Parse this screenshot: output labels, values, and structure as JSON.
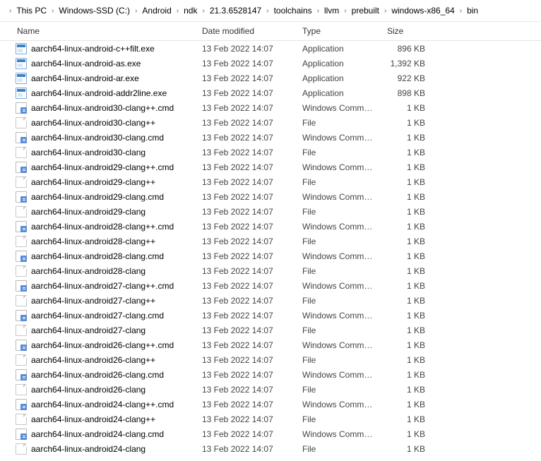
{
  "breadcrumb": [
    "This PC",
    "Windows-SSD (C:)",
    "Android",
    "ndk",
    "21.3.6528147",
    "toolchains",
    "llvm",
    "prebuilt",
    "windows-x86_64",
    "bin"
  ],
  "columns": {
    "name": "Name",
    "date": "Date modified",
    "type": "Type",
    "size": "Size"
  },
  "files": [
    {
      "icon": "exe",
      "name": "aarch64-linux-android-c++filt.exe",
      "date": "13 Feb 2022 14:07",
      "type": "Application",
      "size": "896 KB"
    },
    {
      "icon": "exe",
      "name": "aarch64-linux-android-as.exe",
      "date": "13 Feb 2022 14:07",
      "type": "Application",
      "size": "1,392 KB"
    },
    {
      "icon": "exe",
      "name": "aarch64-linux-android-ar.exe",
      "date": "13 Feb 2022 14:07",
      "type": "Application",
      "size": "922 KB"
    },
    {
      "icon": "exe",
      "name": "aarch64-linux-android-addr2line.exe",
      "date": "13 Feb 2022 14:07",
      "type": "Application",
      "size": "898 KB"
    },
    {
      "icon": "cmd",
      "name": "aarch64-linux-android30-clang++.cmd",
      "date": "13 Feb 2022 14:07",
      "type": "Windows Comma...",
      "size": "1 KB"
    },
    {
      "icon": "file",
      "name": "aarch64-linux-android30-clang++",
      "date": "13 Feb 2022 14:07",
      "type": "File",
      "size": "1 KB"
    },
    {
      "icon": "cmd",
      "name": "aarch64-linux-android30-clang.cmd",
      "date": "13 Feb 2022 14:07",
      "type": "Windows Comma...",
      "size": "1 KB"
    },
    {
      "icon": "file",
      "name": "aarch64-linux-android30-clang",
      "date": "13 Feb 2022 14:07",
      "type": "File",
      "size": "1 KB"
    },
    {
      "icon": "cmd",
      "name": "aarch64-linux-android29-clang++.cmd",
      "date": "13 Feb 2022 14:07",
      "type": "Windows Comma...",
      "size": "1 KB"
    },
    {
      "icon": "file",
      "name": "aarch64-linux-android29-clang++",
      "date": "13 Feb 2022 14:07",
      "type": "File",
      "size": "1 KB"
    },
    {
      "icon": "cmd",
      "name": "aarch64-linux-android29-clang.cmd",
      "date": "13 Feb 2022 14:07",
      "type": "Windows Comma...",
      "size": "1 KB"
    },
    {
      "icon": "file",
      "name": "aarch64-linux-android29-clang",
      "date": "13 Feb 2022 14:07",
      "type": "File",
      "size": "1 KB"
    },
    {
      "icon": "cmd",
      "name": "aarch64-linux-android28-clang++.cmd",
      "date": "13 Feb 2022 14:07",
      "type": "Windows Comma...",
      "size": "1 KB"
    },
    {
      "icon": "file",
      "name": "aarch64-linux-android28-clang++",
      "date": "13 Feb 2022 14:07",
      "type": "File",
      "size": "1 KB"
    },
    {
      "icon": "cmd",
      "name": "aarch64-linux-android28-clang.cmd",
      "date": "13 Feb 2022 14:07",
      "type": "Windows Comma...",
      "size": "1 KB"
    },
    {
      "icon": "file",
      "name": "aarch64-linux-android28-clang",
      "date": "13 Feb 2022 14:07",
      "type": "File",
      "size": "1 KB"
    },
    {
      "icon": "cmd",
      "name": "aarch64-linux-android27-clang++.cmd",
      "date": "13 Feb 2022 14:07",
      "type": "Windows Comma...",
      "size": "1 KB"
    },
    {
      "icon": "file",
      "name": "aarch64-linux-android27-clang++",
      "date": "13 Feb 2022 14:07",
      "type": "File",
      "size": "1 KB"
    },
    {
      "icon": "cmd",
      "name": "aarch64-linux-android27-clang.cmd",
      "date": "13 Feb 2022 14:07",
      "type": "Windows Comma...",
      "size": "1 KB"
    },
    {
      "icon": "file",
      "name": "aarch64-linux-android27-clang",
      "date": "13 Feb 2022 14:07",
      "type": "File",
      "size": "1 KB"
    },
    {
      "icon": "cmd",
      "name": "aarch64-linux-android26-clang++.cmd",
      "date": "13 Feb 2022 14:07",
      "type": "Windows Comma...",
      "size": "1 KB"
    },
    {
      "icon": "file",
      "name": "aarch64-linux-android26-clang++",
      "date": "13 Feb 2022 14:07",
      "type": "File",
      "size": "1 KB"
    },
    {
      "icon": "cmd",
      "name": "aarch64-linux-android26-clang.cmd",
      "date": "13 Feb 2022 14:07",
      "type": "Windows Comma...",
      "size": "1 KB"
    },
    {
      "icon": "file",
      "name": "aarch64-linux-android26-clang",
      "date": "13 Feb 2022 14:07",
      "type": "File",
      "size": "1 KB"
    },
    {
      "icon": "cmd",
      "name": "aarch64-linux-android24-clang++.cmd",
      "date": "13 Feb 2022 14:07",
      "type": "Windows Comma...",
      "size": "1 KB"
    },
    {
      "icon": "file",
      "name": "aarch64-linux-android24-clang++",
      "date": "13 Feb 2022 14:07",
      "type": "File",
      "size": "1 KB"
    },
    {
      "icon": "cmd",
      "name": "aarch64-linux-android24-clang.cmd",
      "date": "13 Feb 2022 14:07",
      "type": "Windows Comma...",
      "size": "1 KB"
    },
    {
      "icon": "file",
      "name": "aarch64-linux-android24-clang",
      "date": "13 Feb 2022 14:07",
      "type": "File",
      "size": "1 KB"
    }
  ]
}
